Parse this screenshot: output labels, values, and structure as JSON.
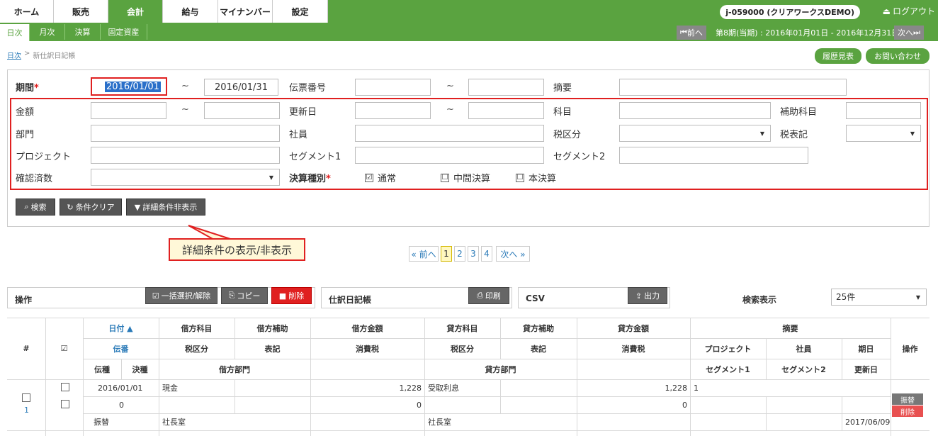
{
  "top_tabs": [
    {
      "label": "ホーム"
    },
    {
      "label": "販売"
    },
    {
      "label": "会計"
    },
    {
      "label": "給与"
    },
    {
      "label": "マイナンバー"
    },
    {
      "label": "設定"
    }
  ],
  "user": {
    "name": "j-059000 (クリアワークスDEMO)",
    "logout": "ログアウト",
    "logout_icon": "eject-icon"
  },
  "sub_tabs": [
    {
      "label": "日次"
    },
    {
      "label": "月次"
    },
    {
      "label": "決算"
    },
    {
      "label": "固定資産"
    }
  ],
  "period_nav": {
    "prev": "前へ",
    "period_text": "第8期(当期) : 2016年01月01日 - 2016年12月31日",
    "next": "次へ"
  },
  "breadcrumb": {
    "home": "日次",
    "separator": ">",
    "current": "新仕訳日記帳"
  },
  "header_buttons": {
    "history": "履歴見表",
    "contact": "お問い合わせ"
  },
  "search": {
    "period_label": "期間",
    "required_mark": "*",
    "period_from": "2016/01/01",
    "tilde": "~",
    "period_to": "2016/01/31",
    "slip_label": "伝票番号",
    "memo_label": "摘要",
    "amount_label": "金額",
    "updated_label": "更新日",
    "account_label": "科目",
    "sub_account_label": "補助科目",
    "dept_label": "部門",
    "employee_label": "社員",
    "tax_label": "税区分",
    "tax_notation_label": "税表記",
    "project_label": "プロジェクト",
    "segment1_label": "セグメント1",
    "segment2_label": "セグメント2",
    "confirmed_label": "確認済数",
    "settle_type_label": "決算種別",
    "settle_types": [
      {
        "label": "通常",
        "checked": "☑"
      },
      {
        "label": "中間決算",
        "checked": "☐"
      },
      {
        "label": "本決算",
        "checked": "☐"
      }
    ]
  },
  "search_buttons": {
    "search": "検索",
    "clear": "条件クリア",
    "toggle": "詳細条件非表示"
  },
  "callout": "詳細条件の表示/非表示",
  "pagination": {
    "prev": "« 前へ",
    "pages": [
      "1",
      "2",
      "3",
      "4"
    ],
    "next": "次へ »"
  },
  "operations": {
    "title": "操作",
    "select_all": "一括選択/解除",
    "copy": "コピー",
    "delete": "削除",
    "journal_title": "仕訳日記帳",
    "print": "印刷",
    "csv_title": "CSV",
    "export": "出力",
    "display_title": "検索表示",
    "display_value": "25件"
  },
  "table": {
    "h_num": "#",
    "h_check": "☑",
    "h_date": "日付 ▲",
    "h_slip": "伝番",
    "h_kind": "伝種",
    "h_settle": "決種",
    "h_debit_acc": "借方科目",
    "h_debit_sub": "借方補助",
    "h_debit_amt": "借方金額",
    "h_tax1": "税区分",
    "h_note1": "表記",
    "h_ctax1": "消費税",
    "h_debit_dept": "借方部門",
    "h_credit_acc": "貸方科目",
    "h_credit_sub": "貸方補助",
    "h_credit_amt": "貸方金額",
    "h_tax2": "税区分",
    "h_note2": "表記",
    "h_ctax2": "消費税",
    "h_credit_dept": "貸方部門",
    "h_memo": "摘要",
    "h_project": "プロジェクト",
    "h_employee": "社員",
    "h_due": "期日",
    "h_seg1": "セグメント1",
    "h_seg2": "セグメント2",
    "h_updated": "更新日",
    "h_ops": "操作",
    "row": {
      "num": "1",
      "date": "2016/01/01",
      "debit_acc": "現金",
      "debit_amt": "1,228",
      "credit_acc": "受取利息",
      "credit_amt": "1,228",
      "memo": "1",
      "slip": "0",
      "ctax1": "0",
      "ctax2": "0",
      "kind": "振替",
      "debit_dept": "社長室",
      "credit_dept": "社長室",
      "updated": "2017/06/09",
      "transfer_btn": "振替",
      "delete_btn": "削除"
    }
  },
  "colors": {
    "brand_green": "#5aa340",
    "accent_red": "#e02020",
    "link_blue": "#2a7ab8"
  }
}
